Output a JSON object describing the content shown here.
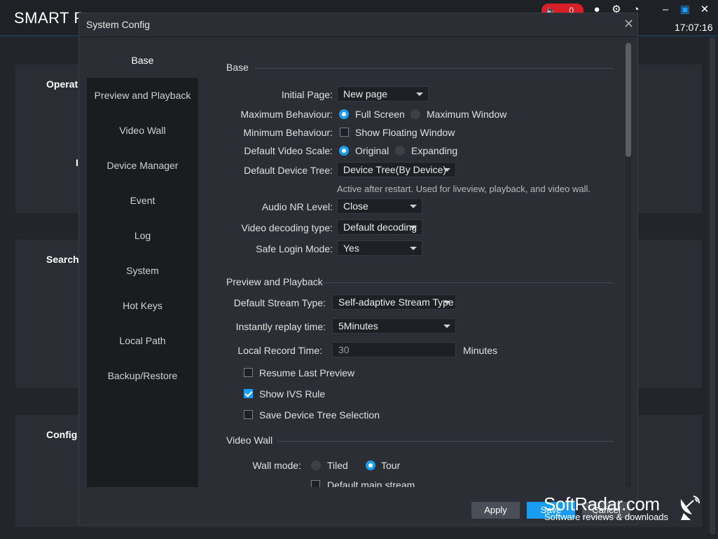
{
  "app": {
    "title": "SMART P",
    "notification_count": "0",
    "clock": "17:07:16",
    "bg_sections": [
      "Operat",
      "I",
      "Search",
      "Config"
    ]
  },
  "dialog": {
    "title": "System Config",
    "close_glyph": "✕",
    "sidebar": [
      "Base",
      "Preview and Playback",
      "Video Wall",
      "Device Manager",
      "Event",
      "Log",
      "System",
      "Hot Keys",
      "Local Path",
      "Backup/Restore"
    ],
    "active_item": "Base"
  },
  "base": {
    "section_title": "Base",
    "initial_page": {
      "label": "Initial Page:",
      "value": "New page"
    },
    "max_behaviour": {
      "label": "Maximum Behaviour:",
      "opt1": "Full Screen",
      "opt2": "Maximum Window",
      "selected": "Full Screen"
    },
    "min_behaviour": {
      "label": "Minimum Behaviour:",
      "option": "Show Floating Window",
      "checked": false
    },
    "video_scale": {
      "label": "Default Video Scale:",
      "opt1": "Original",
      "opt2": "Expanding",
      "selected": "Original"
    },
    "device_tree": {
      "label": "Default Device Tree:",
      "value": "Device Tree(By Device)",
      "hint": "Active after restart. Used for liveview, playback, and video wall."
    },
    "audio_nr": {
      "label": "Audio NR Level:",
      "value": "Close"
    },
    "video_decoding": {
      "label": "Video decoding type:",
      "value": "Default decoding"
    },
    "safe_login": {
      "label": "Safe Login Mode:",
      "value": "Yes"
    }
  },
  "preview": {
    "section_title": "Preview and Playback",
    "stream_type": {
      "label": "Default Stream Type:",
      "value": "Self-adaptive Stream Type"
    },
    "replay_time": {
      "label": "Instantly replay time:",
      "value": "5Minutes"
    },
    "record_time": {
      "label": "Local Record Time:",
      "value": "30",
      "unit": "Minutes"
    },
    "resume_last": {
      "label": "Resume Last Preview",
      "checked": false
    },
    "show_ivs": {
      "label": "Show IVS Rule",
      "checked": true
    },
    "save_tree": {
      "label": "Save Device Tree Selection",
      "checked": false
    }
  },
  "videowall": {
    "section_title": "Video Wall",
    "wall_mode": {
      "label": "Wall mode:",
      "opt1": "Tiled",
      "opt2": "Tour",
      "selected": "Tour"
    },
    "default_main": {
      "label": "Default main stream",
      "checked": false
    }
  },
  "buttons": {
    "apply": "Apply",
    "save": "Save",
    "cancel": "Cancel"
  },
  "watermark": {
    "text": "SoftRadar.com",
    "sub": "Software reviews & downloads"
  },
  "colors": {
    "accent": "#1a9cf0",
    "background": "#22262b",
    "dialog": "#2b2f35",
    "sidebar": "#1a1c20",
    "notification": "#d61f26"
  }
}
